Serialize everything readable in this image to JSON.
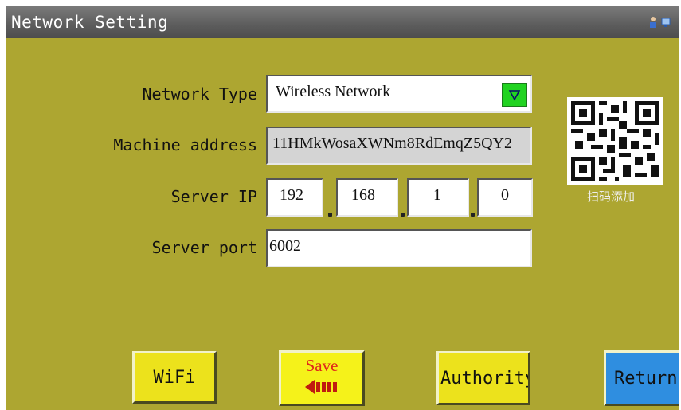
{
  "window": {
    "title": "Network Setting"
  },
  "form": {
    "network_type": {
      "label": "Network Type",
      "value": "Wireless Network"
    },
    "machine_address": {
      "label": "Machine address",
      "value": "11HMkWosaXWNm8RdEmqZ5QY2"
    },
    "server_ip": {
      "label": "Server IP",
      "octets": [
        "192",
        "168",
        "1",
        "0"
      ]
    },
    "server_port": {
      "label": "Server port",
      "value": "6002"
    }
  },
  "qr": {
    "caption": "扫码添加"
  },
  "buttons": {
    "wifi": "WiFi",
    "save": "Save",
    "authority": "Authority",
    "return": "Return"
  },
  "colors": {
    "background": "#ada631",
    "titlebar": "#5e5e5e",
    "dropdown_button": "#21d321",
    "save_button": "#f5f21a",
    "return_button": "#2f8ee0",
    "button": "#ece21c"
  }
}
